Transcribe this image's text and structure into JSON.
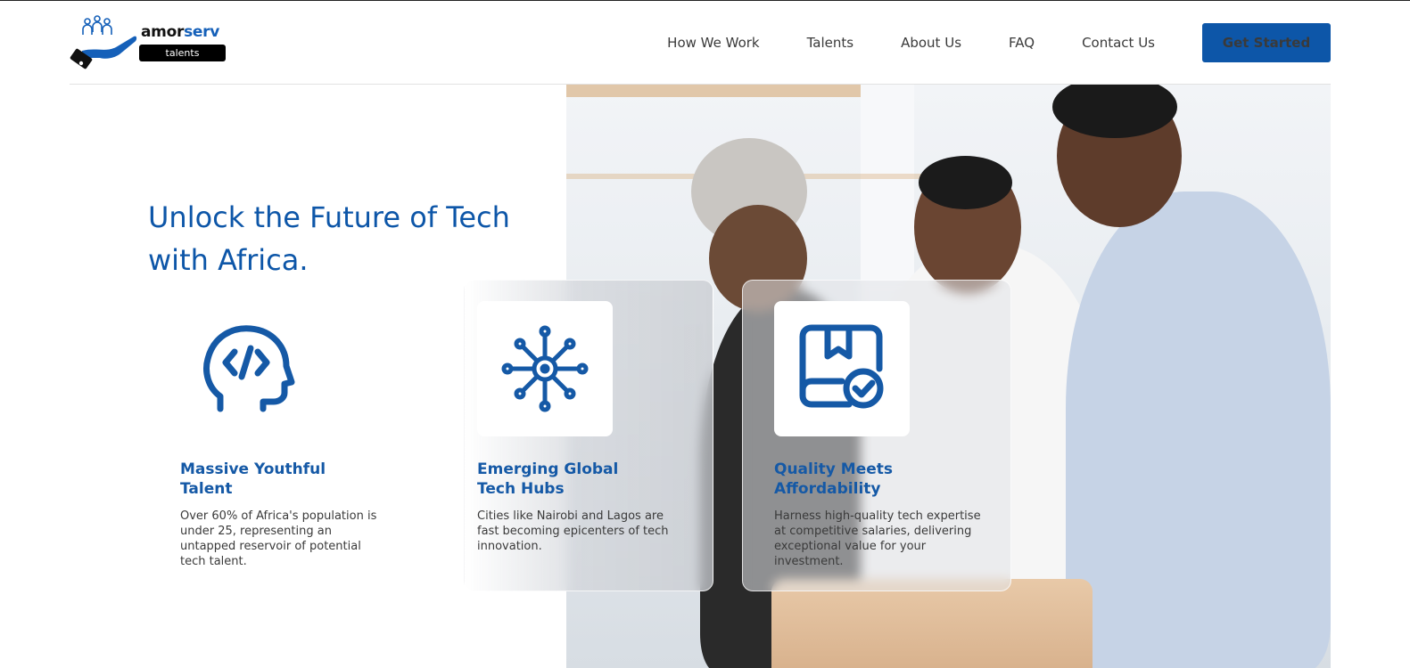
{
  "brand": {
    "name_part1": "amor",
    "name_part2": "serv",
    "tagline": "talents"
  },
  "nav": {
    "items": [
      "How We Work",
      "Talents",
      "About Us",
      "FAQ",
      "Contact Us"
    ],
    "cta": "Get Started"
  },
  "hero": {
    "headline_line1": "Unlock the Future of Tech",
    "headline_line2": "with Africa."
  },
  "features": [
    {
      "icon": "code-head-icon",
      "title_line1": "Massive Youthful",
      "title_line2": "Talent",
      "description": "Over 60% of Africa's population is under 25, representing an untapped reservoir of potential tech talent."
    },
    {
      "icon": "network-hub-icon",
      "title_line1": "Emerging Global",
      "title_line2": "Tech Hubs",
      "description": "Cities like Nairobi and Lagos are fast becoming epicenters of tech innovation."
    },
    {
      "icon": "quality-check-icon",
      "title_line1": "Quality Meets",
      "title_line2": "Affordability",
      "description": "Harness high-quality tech expertise at competitive salaries, delivering exceptional value for your investment."
    }
  ],
  "colors": {
    "brand_blue": "#0d56a8",
    "text_dark": "#3a3a3a"
  }
}
